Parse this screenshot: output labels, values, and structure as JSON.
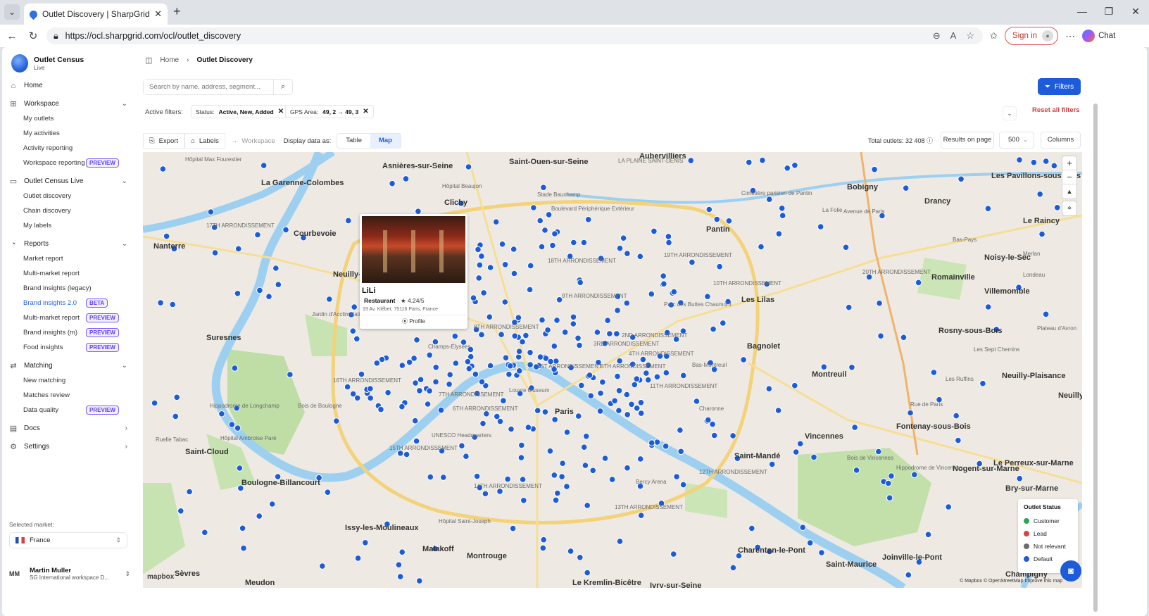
{
  "browser": {
    "tab_title": "Outlet Discovery | SharpGrid Outle",
    "url": "https://ocl.sharpgrid.com/ocl/outlet_discovery",
    "sign_in": "Sign in",
    "chat": "Chat"
  },
  "sidebar": {
    "brand_title": "Outlet Census",
    "brand_sub": "Live",
    "home": "Home",
    "workspace": {
      "label": "Workspace",
      "items": [
        "My outlets",
        "My activities",
        "Activity reporting",
        "Workspace reporting"
      ],
      "badge": "PREVIEW"
    },
    "ocl": {
      "label": "Outlet Census Live",
      "items": [
        "Outlet discovery",
        "Chain discovery",
        "My labels"
      ]
    },
    "reports": {
      "label": "Reports",
      "items": [
        "Market report",
        "Multi-market report",
        "Brand insights (legacy)",
        "Brand insights 2.0",
        "Multi-market report",
        "Brand insights (m)",
        "Food insights"
      ],
      "badges": [
        "BETA",
        "PREVIEW",
        "PREVIEW",
        "PREVIEW"
      ]
    },
    "matching": {
      "label": "Matching",
      "items": [
        "New matching",
        "Matches review",
        "Data quality"
      ],
      "badge": "PREVIEW"
    },
    "docs": "Docs",
    "settings": "Settings",
    "selected_market_label": "Selected market:",
    "market": "France",
    "user_initials": "MM",
    "user_name": "Martin Muller",
    "user_workspace": "SG International workspace D..."
  },
  "header": {
    "crumb_home": "Home",
    "crumb_current": "Outlet Discovery",
    "search_placeholder": "Search by name, address, segment...",
    "filters": "Filters",
    "active_filters": "Active filters:",
    "chip1_key": "Status:",
    "chip1_val": "Active, New, Added",
    "chip2_key": "GPS Area:",
    "chip2_val": "49, 2 → 49, 3",
    "reset": "Reset all filters"
  },
  "toolbar": {
    "export": "Export",
    "labels": "Labels",
    "workspace": "Workspace",
    "display_as": "Display data as:",
    "table": "Table",
    "map": "Map",
    "total": "Total outlets: 32 408",
    "results_on_page": "Results on page",
    "page_size": "500",
    "columns": "Columns"
  },
  "popup": {
    "name": "LiLi",
    "category": "Restaurant",
    "rating": "★ 4.24/5",
    "address": "19 Av. Kléber, 75116 Paris, France",
    "profile": "Profile"
  },
  "legend": {
    "title": "Outlet Status",
    "items": [
      {
        "label": "Customer",
        "color": "#2fa35a"
      },
      {
        "label": "Lead",
        "color": "#d64541"
      },
      {
        "label": "Not relevant",
        "color": "#6b6b6b"
      },
      {
        "label": "Default",
        "color": "#1d5cd8"
      }
    ]
  },
  "map_labels": {
    "big": [
      "Asnières-sur-Seine",
      "Saint-Ouen-sur-Seine",
      "La Garenne-Colombes",
      "Clichy",
      "Bobigny",
      "Les Pavillons-sous-Bois",
      "Nanterre",
      "Courbevoie",
      "Neuilly-sur-Seine",
      "Pantin",
      "Le Raincy",
      "Noisy-le-Sec",
      "Romainville",
      "Villemomble",
      "Les Lilas",
      "Rosny-sous-Bois",
      "Suresnes",
      "Bagnolet",
      "Montreuil",
      "Neuilly-Plaisance",
      "Neuilly-sur-Marne",
      "Paris",
      "Fontenay-sous-Bois",
      "Vincennes",
      "Saint-Cloud",
      "Saint-Mandé",
      "Nogent-sur-Marne",
      "Le Perreux-sur-Marne",
      "Bry-sur-Marne",
      "Boulogne-Billancourt",
      "Issy-les-Moulineaux",
      "Malakoff",
      "Montrouge",
      "Charenton-le-Pont",
      "Saint-Maurice",
      "Joinville-le-Pont",
      "Sèvres",
      "Meudon",
      "Le Kremlin-Bicêtre",
      "Ivry-sur-Seine",
      "Champigny",
      "Aubervilliers",
      "Drancy"
    ],
    "small": [
      "LA PLAINE SAINT-DENIS",
      "17TH ARRONDISSEMENT",
      "18TH ARRONDISSEMENT",
      "19TH ARRONDISSEMENT",
      "20TH ARRONDISSEMENT",
      "10TH ARRONDISSEMENT",
      "9TH ARRONDISSEMENT",
      "8TH ARRONDISSEMENT",
      "16TH ARRONDISSEMENT",
      "15TH ARRONDISSEMENT",
      "7TH ARRONDISSEMENT",
      "6TH ARRONDISSEMENT",
      "5TH ARRONDISSEMENT",
      "4TH ARRONDISSEMENT",
      "11TH ARRONDISSEMENT",
      "12TH ARRONDISSEMENT",
      "13TH ARRONDISSEMENT",
      "14TH ARRONDISSEMENT",
      "3RD ARRONDISSEMENT",
      "2ND ARRONDISSEMENT",
      "1ST ARRONDISSEMENT",
      "Bois de Boulogne",
      "Bois de Vincennes",
      "Parc des Buttes Chaumont",
      "Champs-Élysées",
      "Hôpital Saint-Joseph",
      "Hôpital Ambroise Paré",
      "Louvre Museum",
      "UNESCO Headquarters",
      "Hippodrome de Longchamp",
      "Cimetière parisien de Pantin",
      "La Folie",
      "Bas-Pays",
      "Merlan",
      "Londeau",
      "Bas-Montreuil",
      "Charonne",
      "Bercy Arena",
      "Hôpital Max Fourestier",
      "Stade Bauchamp",
      "Boulevard Périphérique Extérieur",
      "Rue de Paris",
      "Avenue de Paris",
      "Hippodrome de Vincennes",
      "Plateau d'Avron",
      "Les Sept Chemins",
      "Les Ruffins",
      "Ruelle Tabac",
      "Hôpital Beaujon",
      "Jardin d'Acclimatation"
    ]
  },
  "map_attrib": "© Mapbox © OpenStreetMap Improve this map",
  "map_logo": "mapbox"
}
